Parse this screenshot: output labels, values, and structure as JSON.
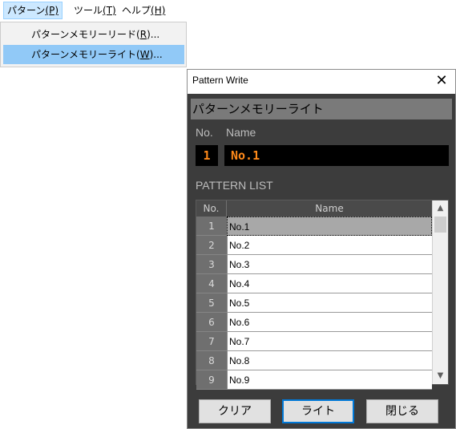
{
  "menubar": {
    "items": [
      {
        "label": "パターン",
        "accel": "(P)",
        "accel_key": "P"
      },
      {
        "label": "ツール",
        "accel": "(T)",
        "accel_key": "T"
      },
      {
        "label": "ヘルプ",
        "accel": "(H)",
        "accel_key": "H"
      }
    ]
  },
  "menu": {
    "items": [
      {
        "label": "パターンメモリーリード",
        "accel_pre": "(",
        "accel_key": "R",
        "accel_post": ")..."
      },
      {
        "label": "パターンメモリーライト",
        "accel_pre": "(",
        "accel_key": "W",
        "accel_post": ")..."
      }
    ]
  },
  "dialog": {
    "title": "Pattern Write",
    "close_glyph": "✕",
    "header": "パターンメモリーライト",
    "no_label": "No.",
    "name_label": "Name",
    "selected_no": "1",
    "selected_name": "No.1",
    "pattern_list_label": "PATTERN LIST",
    "table": {
      "headers": [
        "No.",
        "Name"
      ],
      "rows": [
        {
          "no": "1",
          "name": "No.1"
        },
        {
          "no": "2",
          "name": "No.2"
        },
        {
          "no": "3",
          "name": "No.3"
        },
        {
          "no": "4",
          "name": "No.4"
        },
        {
          "no": "5",
          "name": "No.5"
        },
        {
          "no": "6",
          "name": "No.6"
        },
        {
          "no": "7",
          "name": "No.7"
        },
        {
          "no": "8",
          "name": "No.8"
        },
        {
          "no": "9",
          "name": "No.9"
        }
      ],
      "scroll_up_glyph": "▲",
      "scroll_down_glyph": "▼"
    },
    "buttons": {
      "clear": "クリア",
      "write": "ライト",
      "close": "閉じる"
    }
  },
  "colors": {
    "dialog_bg": "#3c3c3c",
    "selected_value": "#ff8a1a",
    "menu_hover": "#91c9f7",
    "default_button_border": "#0078d7"
  },
  "icons": [
    "close-icon",
    "scroll-up-icon",
    "scroll-down-icon"
  ]
}
